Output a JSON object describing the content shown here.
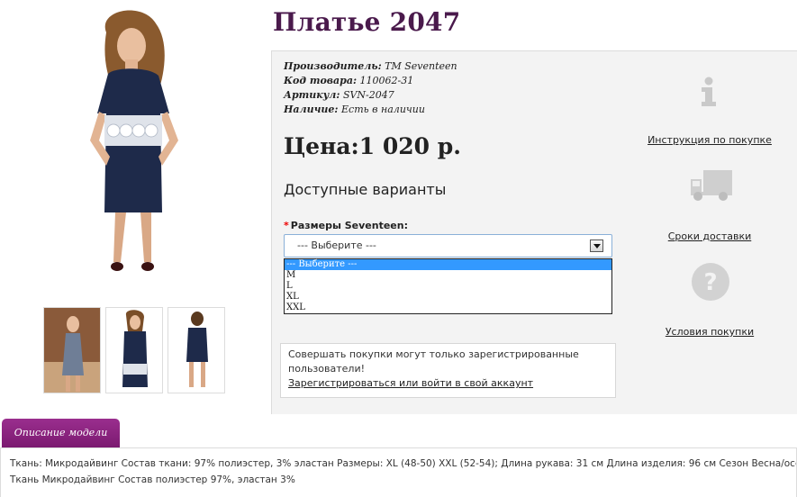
{
  "product": {
    "title": "Платье 2047",
    "meta": {
      "manufacturer_label": "Производитель:",
      "manufacturer_value": "ТМ Seventeen",
      "code_label": "Код товара:",
      "code_value": "110062-31",
      "article_label": "Артикул:",
      "article_value": "SVN-2047",
      "availability_label": "Наличие:",
      "availability_value": "Есть в наличии"
    },
    "price": "Цена:1 020 р.",
    "variants_heading": "Доступные варианты",
    "size_label": "Размеры Seventeen:",
    "required_mark": "*",
    "size_select": {
      "selected": "--- Выберите ---",
      "options": [
        "--- Выберите ---",
        "M",
        "L",
        "XL",
        "XXL"
      ]
    },
    "notice": {
      "text": "Совершать покупки могут только зарегистрированные пользователи!",
      "link": "Зарегистрироваться или войти в свой аккаунт"
    }
  },
  "aside": {
    "instruction": {
      "label": "Инструкция по покупке",
      "icon": "info-icon"
    },
    "delivery": {
      "label": "Сроки доставки",
      "icon": "truck-icon"
    },
    "terms": {
      "label": "Условия покупки",
      "icon": "question-icon"
    }
  },
  "tabs": {
    "description_tab": "Описание модели"
  },
  "description": {
    "line1": "Ткань: Микродайвинг Состав ткани: 97% полиэстер, 3% эластан Размеры: XL (48-50) XXL (52-54); Длина рукава: 31 см Длина изделия: 96 см Сезон Весна/осень",
    "line2": "Ткань Микродайвинг Состав полиэстер 97%, эластан 3%"
  },
  "colors": {
    "title": "#4a1a4c",
    "tab": "#8a2480",
    "dropdown_highlight": "#3399ff"
  }
}
